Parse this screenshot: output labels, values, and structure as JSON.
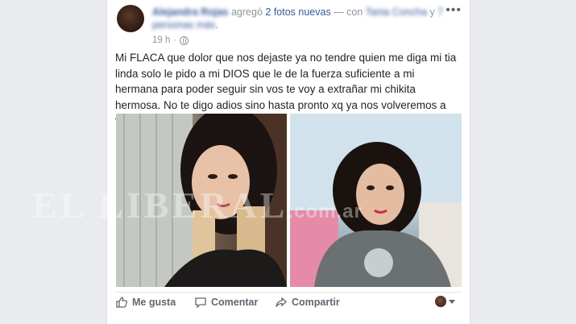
{
  "post": {
    "author": "Alejandra Rojas",
    "action_text": "agregó",
    "photos_link": "2 fotos nuevas",
    "with_text": "— con",
    "tagged_person": "Tania Concha",
    "conj": "y",
    "others_link": "7 personas más",
    "period": ".",
    "timestamp": "19 h",
    "timestamp_sep": "·",
    "menu_label": "•••",
    "text": "Mi FLACA que dolor que nos dejaste ya no tendre quien me diga mi tia linda solo le pido a mi DIOS que le de la fuerza suficiente a mi hermana para poder seguir sin vos te voy a extrañar mi chikita hermosa. No te digo adios sino hasta pronto xq ya nos volveremos a ver TE AMO",
    "emoji_count": 6
  },
  "watermark": {
    "text": "EL LIBERAL",
    "suffix": ".com.ar"
  },
  "actions": {
    "like": "Me gusta",
    "comment": "Comentar",
    "share": "Compartir"
  },
  "colors": {
    "link": "#365899",
    "meta": "#90949c",
    "body_text": "#1d2129",
    "action_text": "#606770",
    "page_bg": "#e9ebee"
  }
}
